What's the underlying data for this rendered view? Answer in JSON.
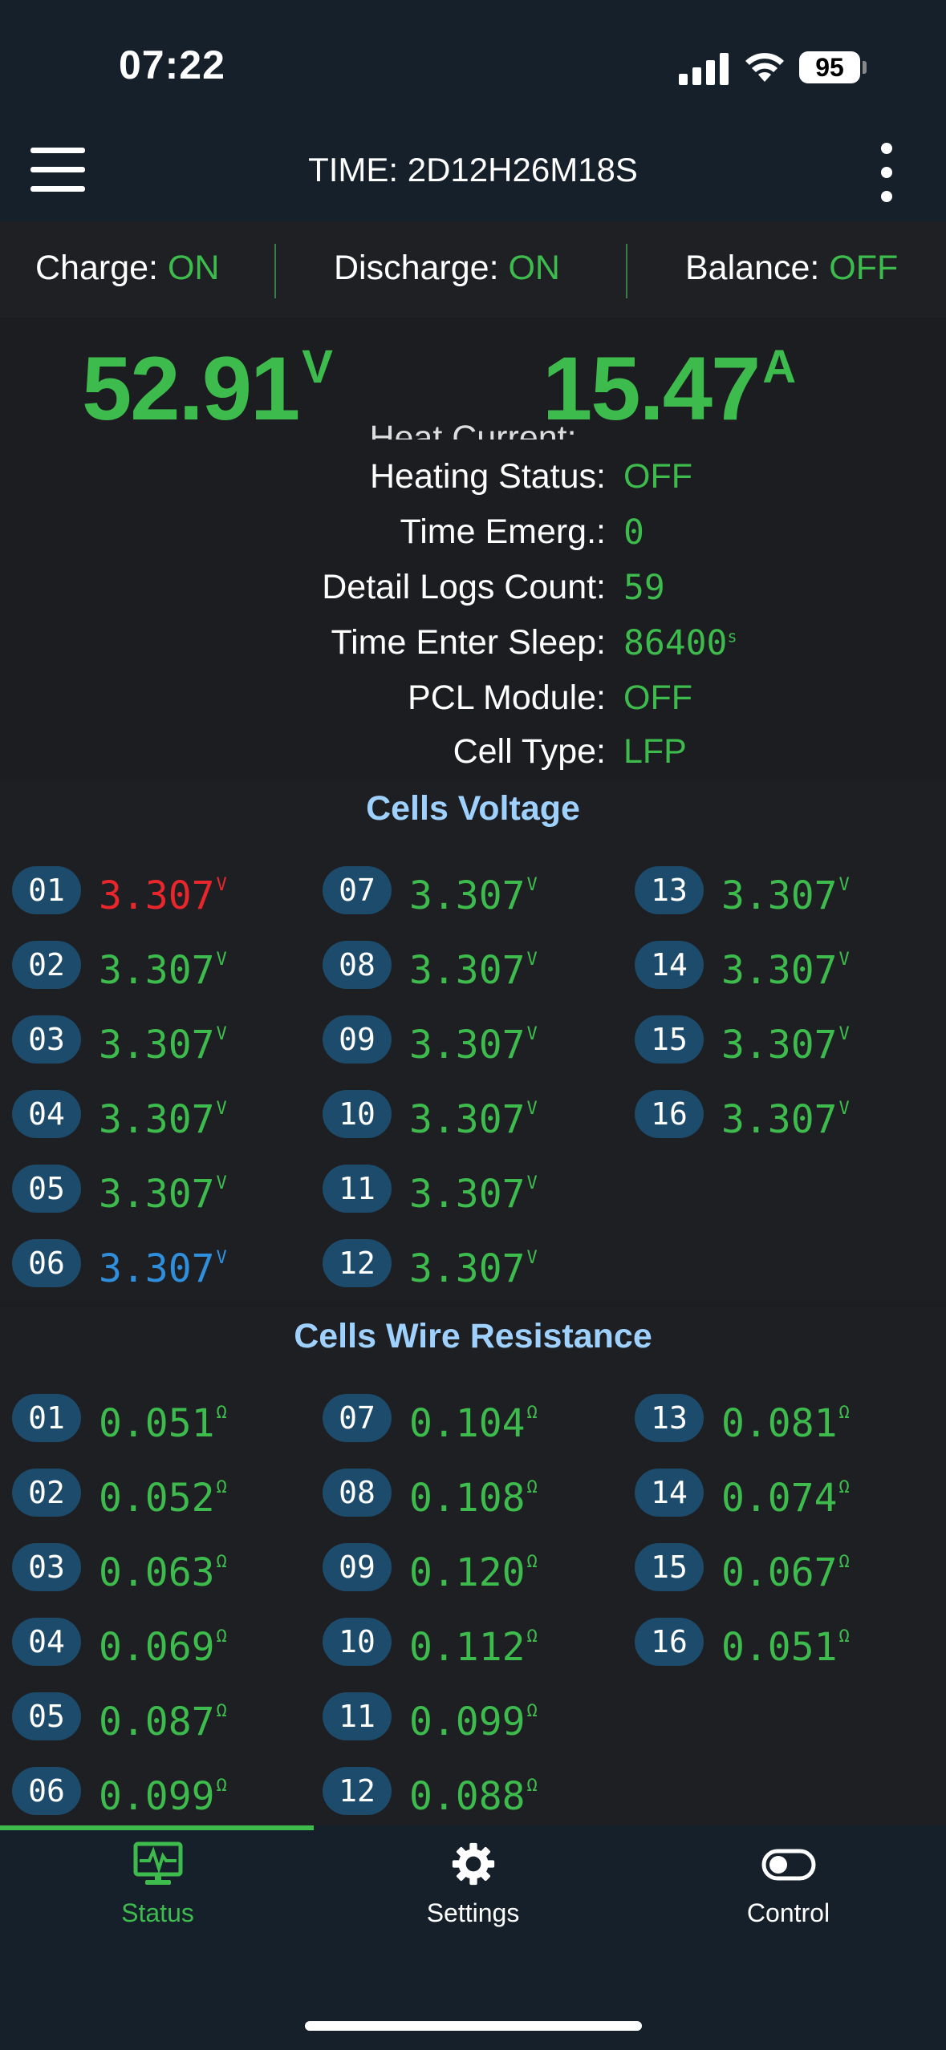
{
  "status_bar": {
    "time": "07:22",
    "battery": "95"
  },
  "app_bar": {
    "title": "TIME: 2D12H26M18S"
  },
  "switches": [
    {
      "label": "Charge: ",
      "value": "ON"
    },
    {
      "label": "Discharge: ",
      "value": "ON"
    },
    {
      "label": "Balance: ",
      "value": "OFF"
    }
  ],
  "readouts": {
    "voltage": "52.91",
    "voltage_unit": "V",
    "current": "15.47",
    "current_unit": "A"
  },
  "clipped_label": "Heat Current:",
  "info_rows": [
    {
      "label": "Heating Status:",
      "value": "OFF",
      "unit": "",
      "mono": false
    },
    {
      "label": "Time Emerg.:",
      "value": "0",
      "unit": "",
      "mono": true
    },
    {
      "label": "Detail Logs Count:",
      "value": "59",
      "unit": "",
      "mono": true
    },
    {
      "label": "Time Enter Sleep:",
      "value": "86400",
      "unit": "s",
      "mono": true
    },
    {
      "label": "PCL Module:",
      "value": "OFF",
      "unit": "",
      "mono": false
    },
    {
      "label": "Cell Type:",
      "value": "LFP",
      "unit": "",
      "mono": false
    }
  ],
  "cells_voltage": {
    "title": "Cells Voltage",
    "unit": "V",
    "items": [
      {
        "index": "01",
        "value": "3.307",
        "color": "#e8262c"
      },
      {
        "index": "02",
        "value": "3.307",
        "color": "#3dbb4d"
      },
      {
        "index": "03",
        "value": "3.307",
        "color": "#3dbb4d"
      },
      {
        "index": "04",
        "value": "3.307",
        "color": "#3dbb4d"
      },
      {
        "index": "05",
        "value": "3.307",
        "color": "#3dbb4d"
      },
      {
        "index": "06",
        "value": "3.307",
        "color": "#2f8fdc"
      },
      {
        "index": "07",
        "value": "3.307",
        "color": "#3dbb4d"
      },
      {
        "index": "08",
        "value": "3.307",
        "color": "#3dbb4d"
      },
      {
        "index": "09",
        "value": "3.307",
        "color": "#3dbb4d"
      },
      {
        "index": "10",
        "value": "3.307",
        "color": "#3dbb4d"
      },
      {
        "index": "11",
        "value": "3.307",
        "color": "#3dbb4d"
      },
      {
        "index": "12",
        "value": "3.307",
        "color": "#3dbb4d"
      },
      {
        "index": "13",
        "value": "3.307",
        "color": "#3dbb4d"
      },
      {
        "index": "14",
        "value": "3.307",
        "color": "#3dbb4d"
      },
      {
        "index": "15",
        "value": "3.307",
        "color": "#3dbb4d"
      },
      {
        "index": "16",
        "value": "3.307",
        "color": "#3dbb4d"
      }
    ]
  },
  "cells_resistance": {
    "title": "Cells Wire Resistance",
    "unit": "Ω",
    "items": [
      {
        "index": "01",
        "value": "0.051",
        "color": "#3dbb4d"
      },
      {
        "index": "02",
        "value": "0.052",
        "color": "#3dbb4d"
      },
      {
        "index": "03",
        "value": "0.063",
        "color": "#3dbb4d"
      },
      {
        "index": "04",
        "value": "0.069",
        "color": "#3dbb4d"
      },
      {
        "index": "05",
        "value": "0.087",
        "color": "#3dbb4d"
      },
      {
        "index": "06",
        "value": "0.099",
        "color": "#3dbb4d"
      },
      {
        "index": "07",
        "value": "0.104",
        "color": "#3dbb4d"
      },
      {
        "index": "08",
        "value": "0.108",
        "color": "#3dbb4d"
      },
      {
        "index": "09",
        "value": "0.120",
        "color": "#3dbb4d"
      },
      {
        "index": "10",
        "value": "0.112",
        "color": "#3dbb4d"
      },
      {
        "index": "11",
        "value": "0.099",
        "color": "#3dbb4d"
      },
      {
        "index": "12",
        "value": "0.088",
        "color": "#3dbb4d"
      },
      {
        "index": "13",
        "value": "0.081",
        "color": "#3dbb4d"
      },
      {
        "index": "14",
        "value": "0.074",
        "color": "#3dbb4d"
      },
      {
        "index": "15",
        "value": "0.067",
        "color": "#3dbb4d"
      },
      {
        "index": "16",
        "value": "0.051",
        "color": "#3dbb4d"
      }
    ]
  },
  "tabs": [
    {
      "label": "Status",
      "icon": "monitor-icon",
      "active": true
    },
    {
      "label": "Settings",
      "icon": "gear-icon",
      "active": false
    },
    {
      "label": "Control",
      "icon": "toggle-icon",
      "active": false
    }
  ],
  "colors": {
    "accent": "#3dbb4d",
    "title": "#9fd1ff",
    "index_pill": "#1c4b6b",
    "min_cell": "#2f8fdc",
    "max_cell": "#e8262c"
  }
}
